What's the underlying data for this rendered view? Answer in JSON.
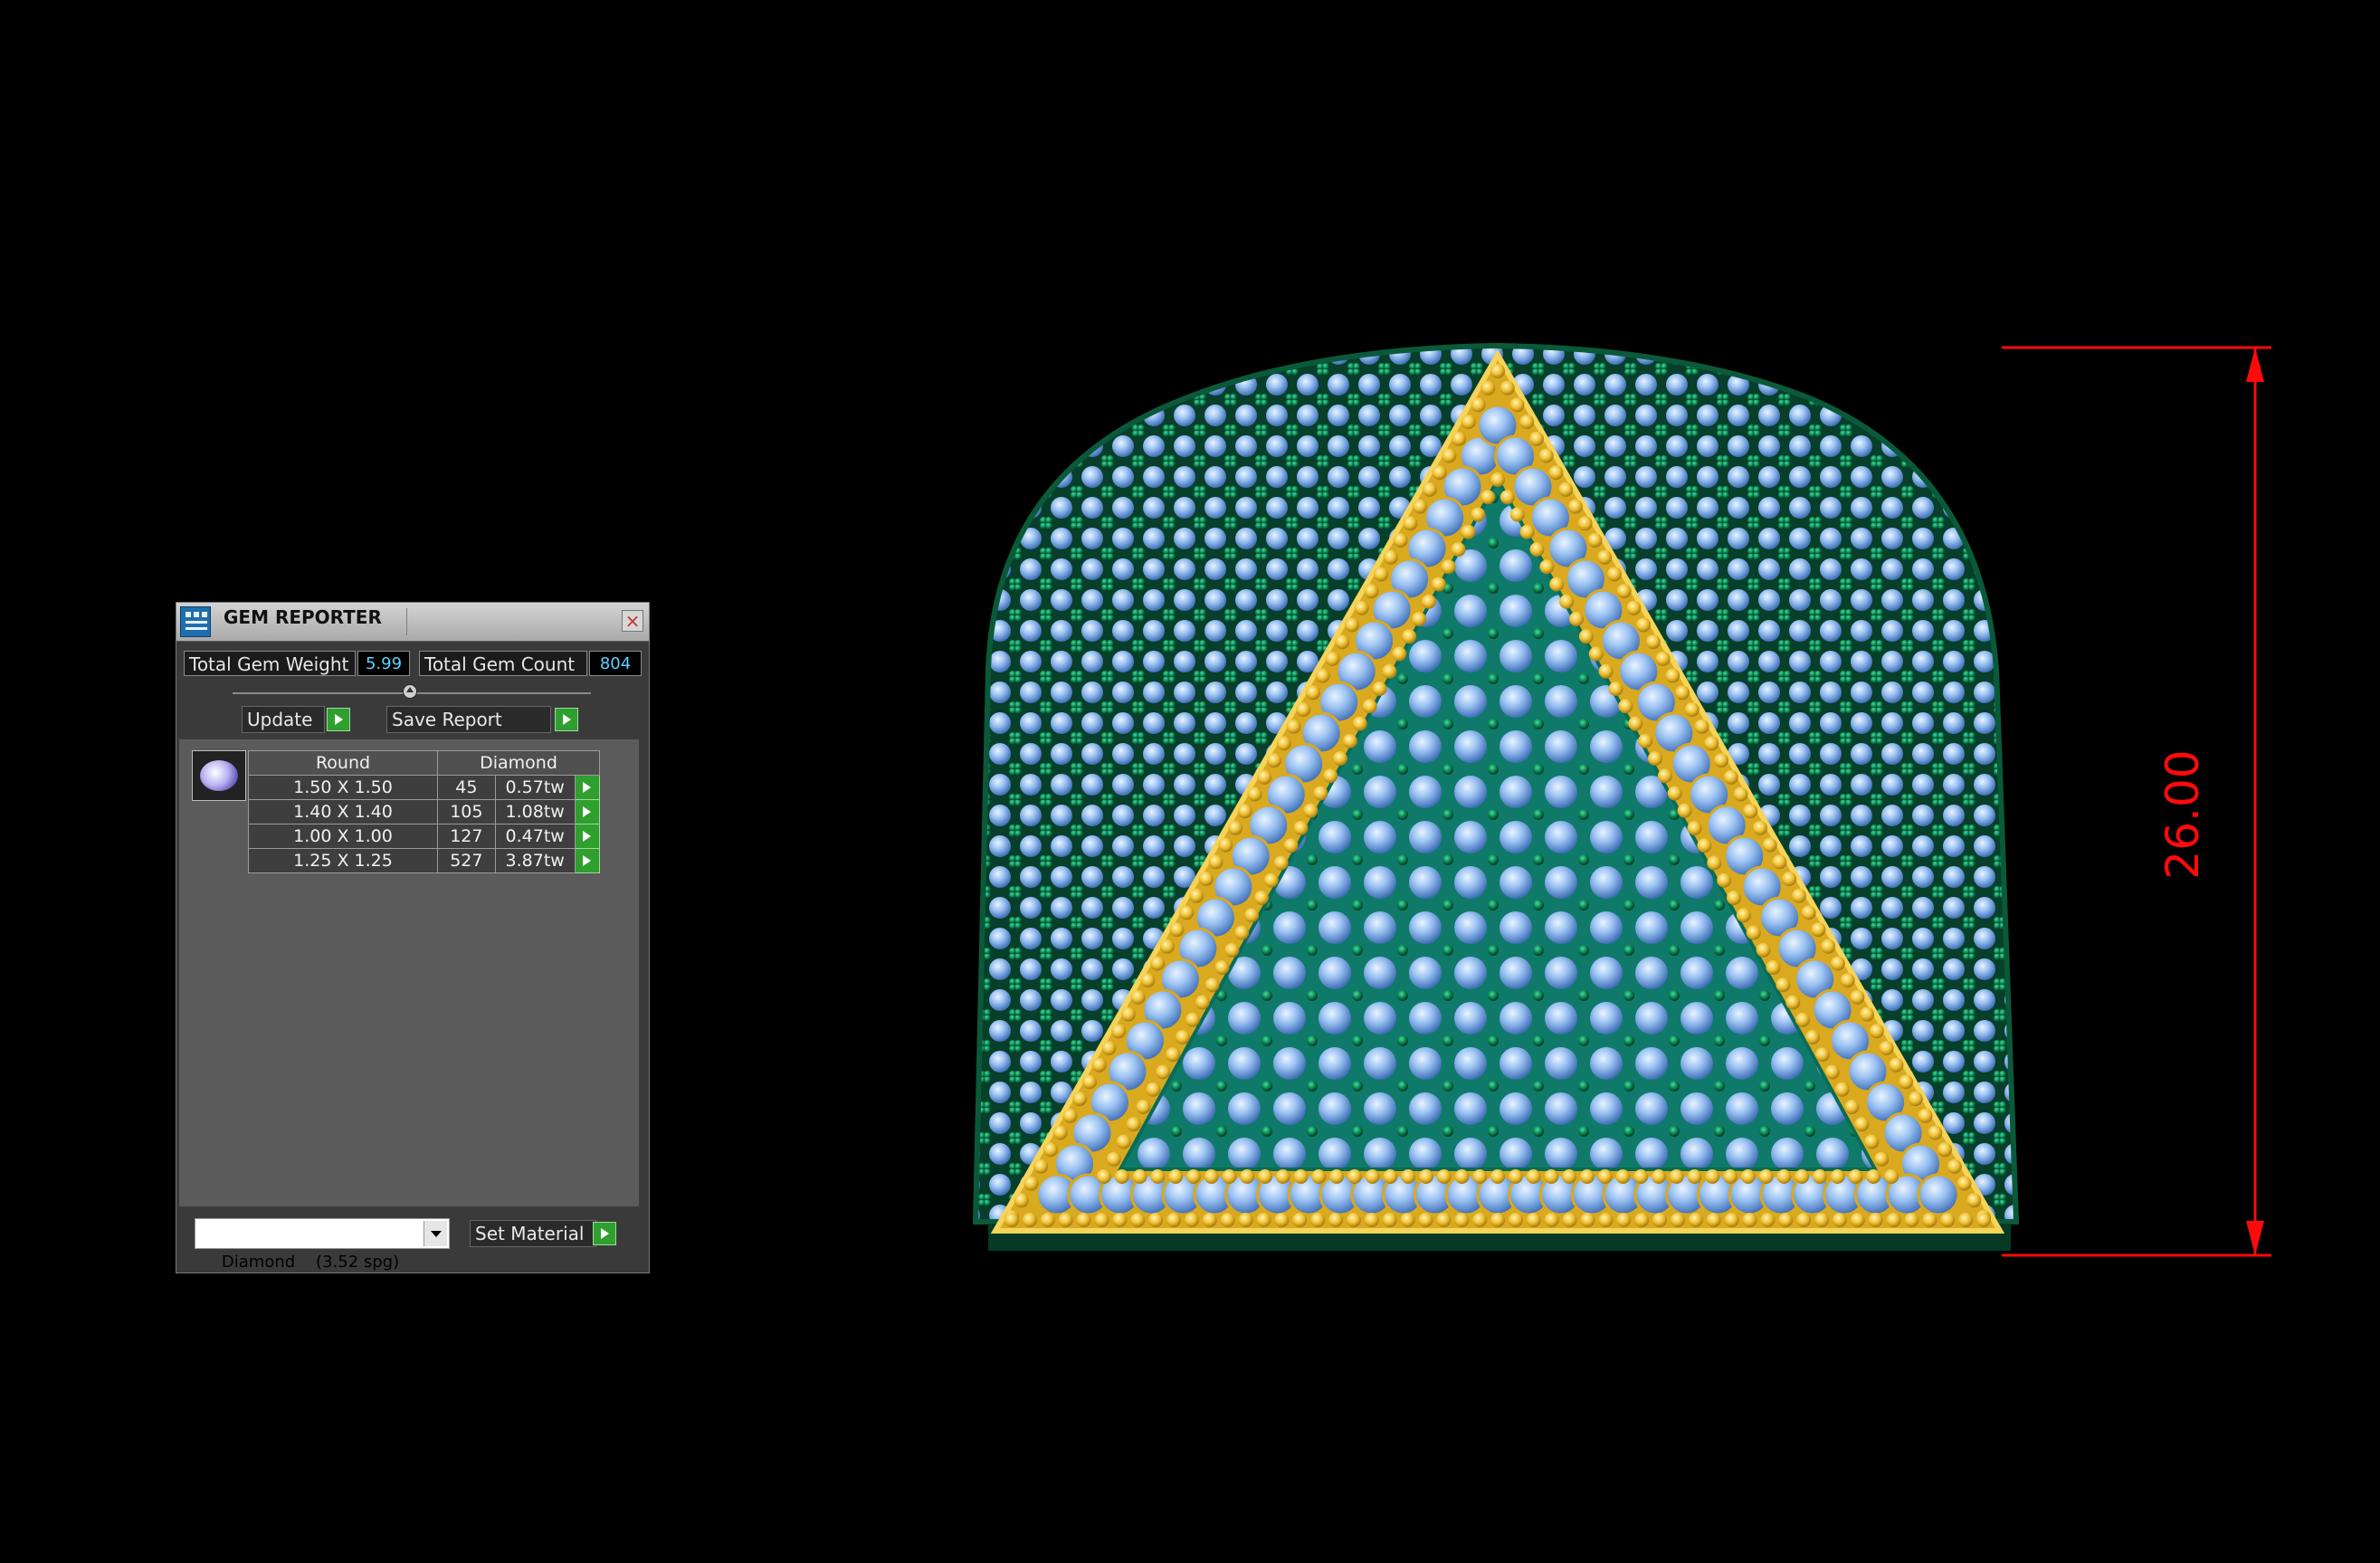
{
  "panel": {
    "title": "GEM REPORTER",
    "close_glyph": "×",
    "total_weight_label": "Total Gem Weight",
    "total_weight_value": "5.99",
    "total_count_label": "Total Gem Count",
    "total_count_value": "804",
    "update_label": "Update",
    "save_report_label": "Save Report",
    "table": {
      "headers": [
        "Round",
        "Diamond"
      ],
      "rows": [
        {
          "size": "1.50 X 1.50",
          "count": "45",
          "weight": "0.57tw"
        },
        {
          "size": "1.40 X 1.40",
          "count": "105",
          "weight": "1.08tw"
        },
        {
          "size": "1.00 X 1.00",
          "count": "127",
          "weight": "0.47tw"
        },
        {
          "size": "1.25 X 1.25",
          "count": "527",
          "weight": "3.87tw"
        }
      ]
    },
    "material_select": "Diamond    (3.52 spg)",
    "set_material_label": "Set Material"
  },
  "viewport": {
    "dimension_value": "26.00",
    "colors": {
      "background": "#000000",
      "dimension": "#ff0a0a",
      "prongs": "#0a6b45",
      "gems": "#8fb8ef",
      "gold": "#f2c43a"
    }
  }
}
